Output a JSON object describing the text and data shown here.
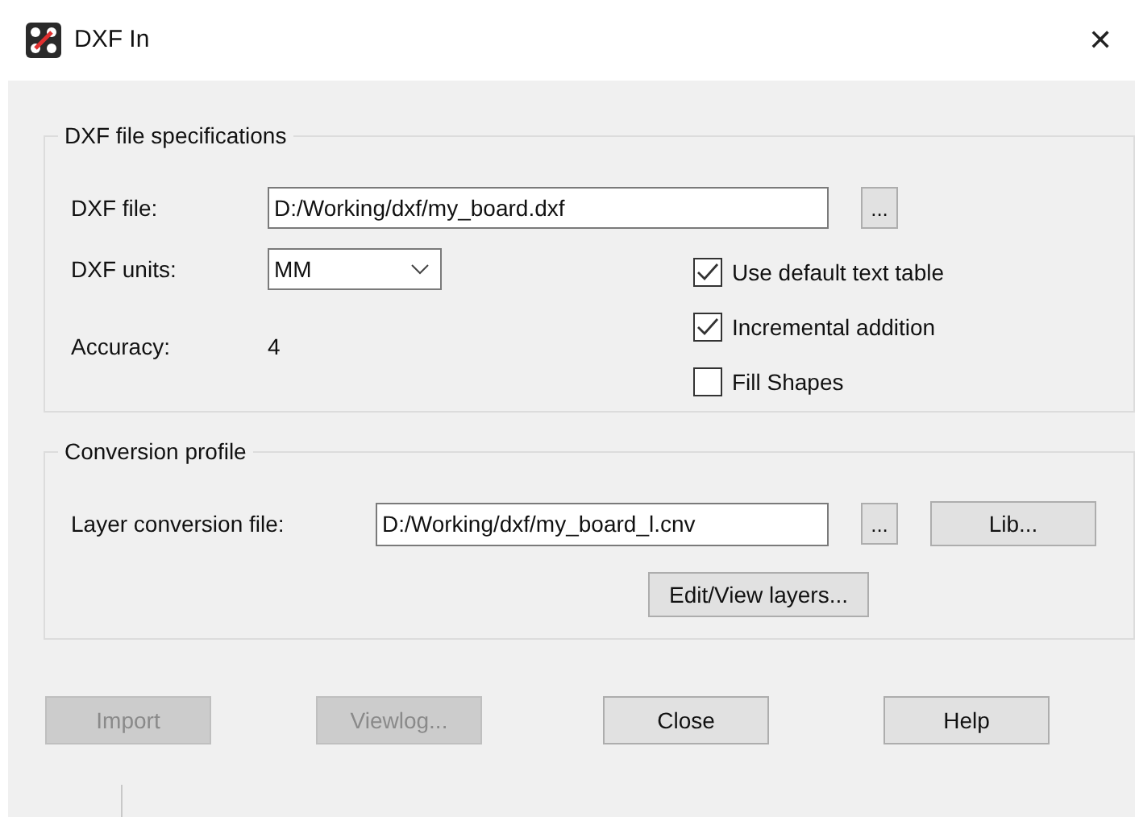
{
  "window": {
    "title": "DXF In",
    "close": "✕"
  },
  "file_specs": {
    "legend": "DXF file specifications",
    "dxf_file": {
      "label": "DXF file:",
      "value": "D:/Working/dxf/my_board.dxf",
      "browse": "..."
    },
    "units": {
      "label": "DXF units:",
      "value": "MM"
    },
    "accuracy": {
      "label": "Accuracy:",
      "value": "4"
    },
    "options": [
      {
        "label": "Use default text table",
        "checked": true
      },
      {
        "label": "Incremental addition",
        "checked": true
      },
      {
        "label": "Fill Shapes",
        "checked": false
      }
    ]
  },
  "conversion": {
    "legend": "Conversion profile",
    "layer_file": {
      "label": "Layer conversion file:",
      "value": "D:/Working/dxf/my_board_l.cnv",
      "browse": "...",
      "lib": "Lib..."
    },
    "edit_button": "Edit/View layers..."
  },
  "buttons": [
    {
      "label": "Import",
      "disabled": true
    },
    {
      "label": "Viewlog...",
      "disabled": true
    },
    {
      "label": "Close",
      "disabled": false
    },
    {
      "label": "Help",
      "disabled": false
    }
  ]
}
